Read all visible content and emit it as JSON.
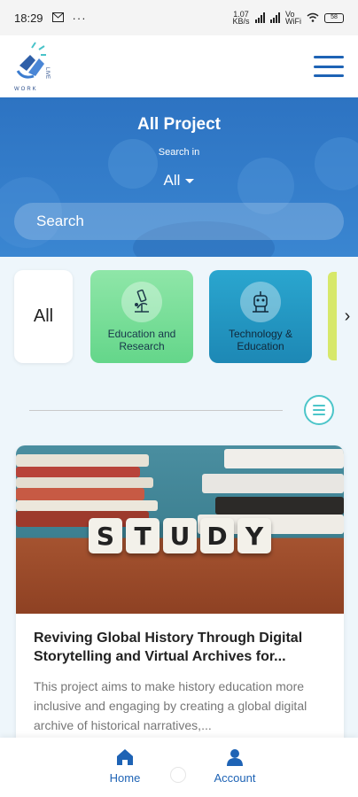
{
  "status_bar": {
    "time": "18:29",
    "network": "Vo WiFi",
    "speed": "1.07 KB/s",
    "battery": "58"
  },
  "header": {
    "logo_text": "WORK",
    "menu_icon": "hamburger-icon"
  },
  "hero": {
    "title": "All Project",
    "search_in_label": "Search in",
    "selected_scope": "All",
    "search_placeholder": "Search"
  },
  "categories": [
    {
      "label": "All",
      "icon": ""
    },
    {
      "label": "Education and Research",
      "icon": "microscope-icon"
    },
    {
      "label": "Technology & Education",
      "icon": "robot-icon"
    }
  ],
  "card": {
    "title": "Reviving Global History Through Digital Storytelling and Virtual Archives for...",
    "description": "This project aims to make history education more inclusive and engaging by creating a global digital archive of historical narratives,...",
    "image_text": [
      "S",
      "T",
      "U",
      "D",
      "Y"
    ]
  },
  "bottom_nav": {
    "home_label": "Home",
    "account_label": "Account"
  },
  "colors": {
    "primary": "#1e63b5",
    "accent": "#4cc5c9",
    "hero": "#2d73c2",
    "edu_card": "#64d68a",
    "tech_card": "#1d88b5"
  }
}
